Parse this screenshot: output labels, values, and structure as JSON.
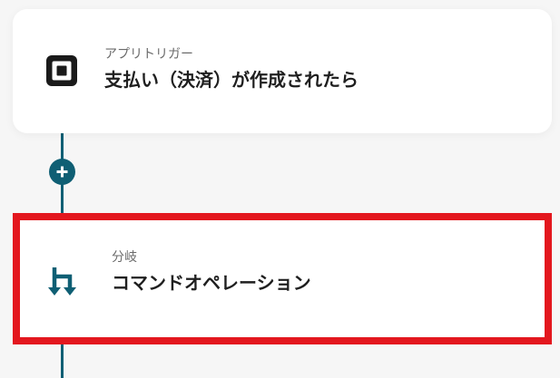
{
  "trigger_card": {
    "icon": "square-app-icon",
    "subtitle": "アプリトリガー",
    "title": "支払い（決済）が作成されたら"
  },
  "add_step": {
    "icon": "plus-icon"
  },
  "branch_card": {
    "icon": "branch-icon",
    "subtitle": "分岐",
    "title": "コマンドオペレーション",
    "highlight_color": "#e3171e"
  },
  "colors": {
    "connector": "#0f5f74",
    "background": "#f6f6f6"
  }
}
